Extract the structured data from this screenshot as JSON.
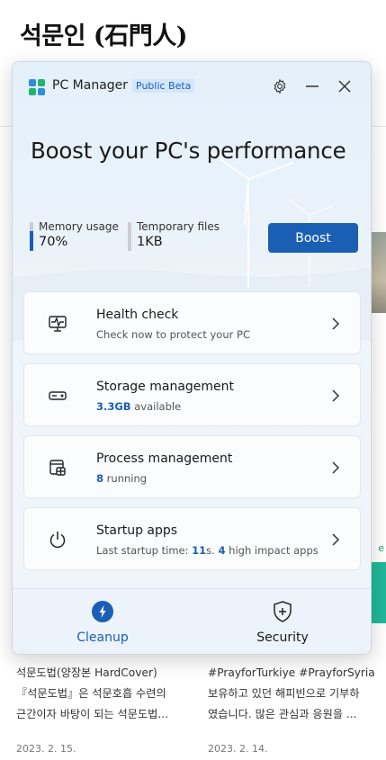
{
  "background_page": {
    "title": "석문인 (石門人)",
    "cards": [
      {
        "lines": [
          "석문도법(양장본 HardCover)",
          "『석문도법』은 석문호흡 수련의",
          "근간이자 바탕이 되는 석문도법..."
        ],
        "date": "2023. 2. 15."
      },
      {
        "lines": [
          "#PrayforTurkiye #PrayforSyria",
          "보유하고 있던 해피빈으로 기부하",
          "였습니다. 많은 관심과 응원을 ..."
        ],
        "date": "2023. 2. 14."
      }
    ]
  },
  "app": {
    "name": "PC Manager",
    "badge": "Public Beta",
    "headline": "Boost your PC's performance",
    "stats": {
      "memory": {
        "label": "Memory usage",
        "value": "70%",
        "fraction": 0.7
      },
      "temp": {
        "label": "Temporary files",
        "value": "1KB",
        "fraction": 0.0
      }
    },
    "boost_label": "Boost",
    "cards": {
      "health": {
        "title": "Health check",
        "sub": "Check now to protect your PC"
      },
      "storage": {
        "title": "Storage management",
        "highlight": "3.3GB",
        "sub_rest": " available"
      },
      "process": {
        "title": "Process management",
        "highlight": "8",
        "sub_rest": " running"
      },
      "startup": {
        "title": "Startup apps",
        "sub_prefix": "Last startup time: ",
        "seconds": "11",
        "mid": "s. ",
        "count": "4",
        "sub_suffix": " high impact apps"
      }
    },
    "nav": {
      "cleanup": "Cleanup",
      "security": "Security"
    },
    "colors": {
      "accent": "#1b5fb5",
      "badge_bg": "#d4e6fb"
    }
  }
}
